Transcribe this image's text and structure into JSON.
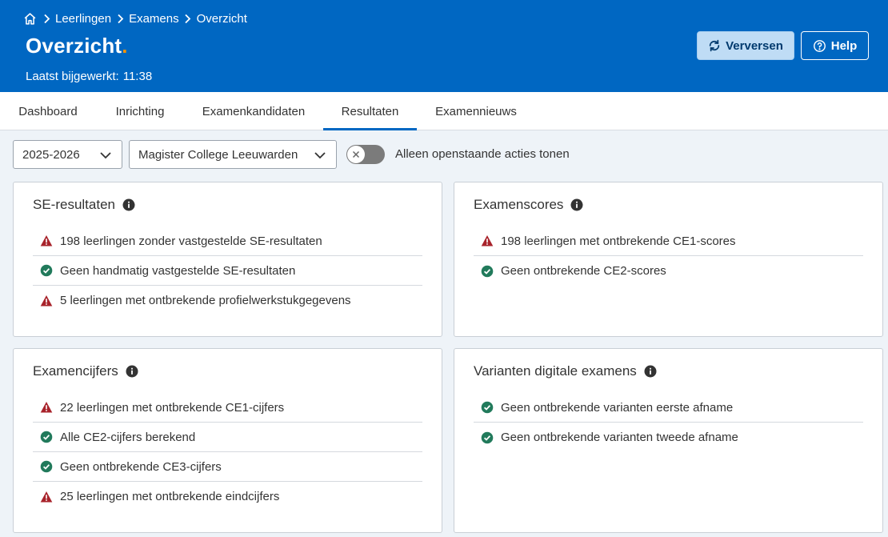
{
  "breadcrumb": {
    "items": [
      "Leerlingen",
      "Examens",
      "Overzicht"
    ]
  },
  "page": {
    "title": "Overzicht",
    "title_dot": ".",
    "updated_label": "Laatst bijgewerkt:",
    "updated_time": "11:38"
  },
  "actions": {
    "refresh_label": "Verversen",
    "help_label": "Help"
  },
  "tabs": [
    {
      "label": "Dashboard"
    },
    {
      "label": "Inrichting"
    },
    {
      "label": "Examenkandidaten"
    },
    {
      "label": "Resultaten",
      "active": true
    },
    {
      "label": "Examennieuws"
    }
  ],
  "filters": {
    "year": "2025-2026",
    "school": "Magister College Leeuwarden",
    "toggle_label": "Alleen openstaande acties tonen",
    "toggle_on": false
  },
  "colors": {
    "header": "#0067c2",
    "accent_dot": "#f39200",
    "warning": "#a8232b",
    "success": "#217a5b"
  },
  "cards": [
    {
      "title": "SE-resultaten",
      "rows": [
        {
          "status": "warning",
          "text": "198 leerlingen zonder vastgestelde SE-resultaten"
        },
        {
          "status": "success",
          "text": "Geen handmatig vastgestelde SE-resultaten"
        },
        {
          "status": "warning",
          "text": "5 leerlingen met ontbrekende profielwerkstukgegevens"
        }
      ]
    },
    {
      "title": "Examenscores",
      "rows": [
        {
          "status": "warning",
          "text": "198 leerlingen met ontbrekende CE1-scores"
        },
        {
          "status": "success",
          "text": "Geen ontbrekende CE2-scores"
        }
      ]
    },
    {
      "title": "Examencijfers",
      "rows": [
        {
          "status": "warning",
          "text": "22 leerlingen met ontbrekende CE1-cijfers"
        },
        {
          "status": "success",
          "text": "Alle CE2-cijfers berekend"
        },
        {
          "status": "success",
          "text": "Geen ontbrekende CE3-cijfers"
        },
        {
          "status": "warning",
          "text": "25 leerlingen met ontbrekende eindcijfers"
        }
      ]
    },
    {
      "title": "Varianten digitale examens",
      "rows": [
        {
          "status": "success",
          "text": "Geen ontbrekende varianten eerste afname"
        },
        {
          "status": "success",
          "text": "Geen ontbrekende varianten tweede afname"
        }
      ]
    }
  ]
}
